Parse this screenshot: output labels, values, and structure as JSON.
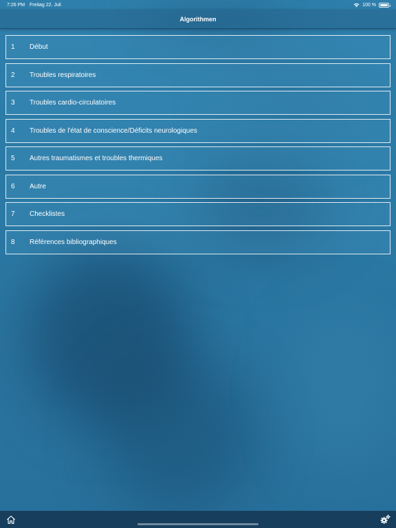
{
  "status_bar": {
    "time": "7:26 PM",
    "date": "Freitag 22. Juli",
    "battery_text": "100 %",
    "battery_level": 1.0
  },
  "navbar": {
    "title": "Algorithmen"
  },
  "menu": {
    "items": [
      {
        "number": "1",
        "label": "Début"
      },
      {
        "number": "2",
        "label": "Troubles respiratoires"
      },
      {
        "number": "3",
        "label": "Troubles cardio-circulatoires"
      },
      {
        "number": "4",
        "label": "Troubles de l'état de conscience/Déficits neurologiques"
      },
      {
        "number": "5",
        "label": "Autres traumatismes et troubles thermiques"
      },
      {
        "number": "6",
        "label": "Autre"
      },
      {
        "number": "7",
        "label": "Checklistes"
      },
      {
        "number": "8",
        "label": "Références bibliographiques"
      }
    ]
  },
  "tab_bar": {
    "left_icon": "home-icon",
    "right_icon": "gears-icon"
  },
  "colors": {
    "accent": "#2a76a2",
    "tab_bar_bg": "#173e5d",
    "text": "#ffffff"
  }
}
